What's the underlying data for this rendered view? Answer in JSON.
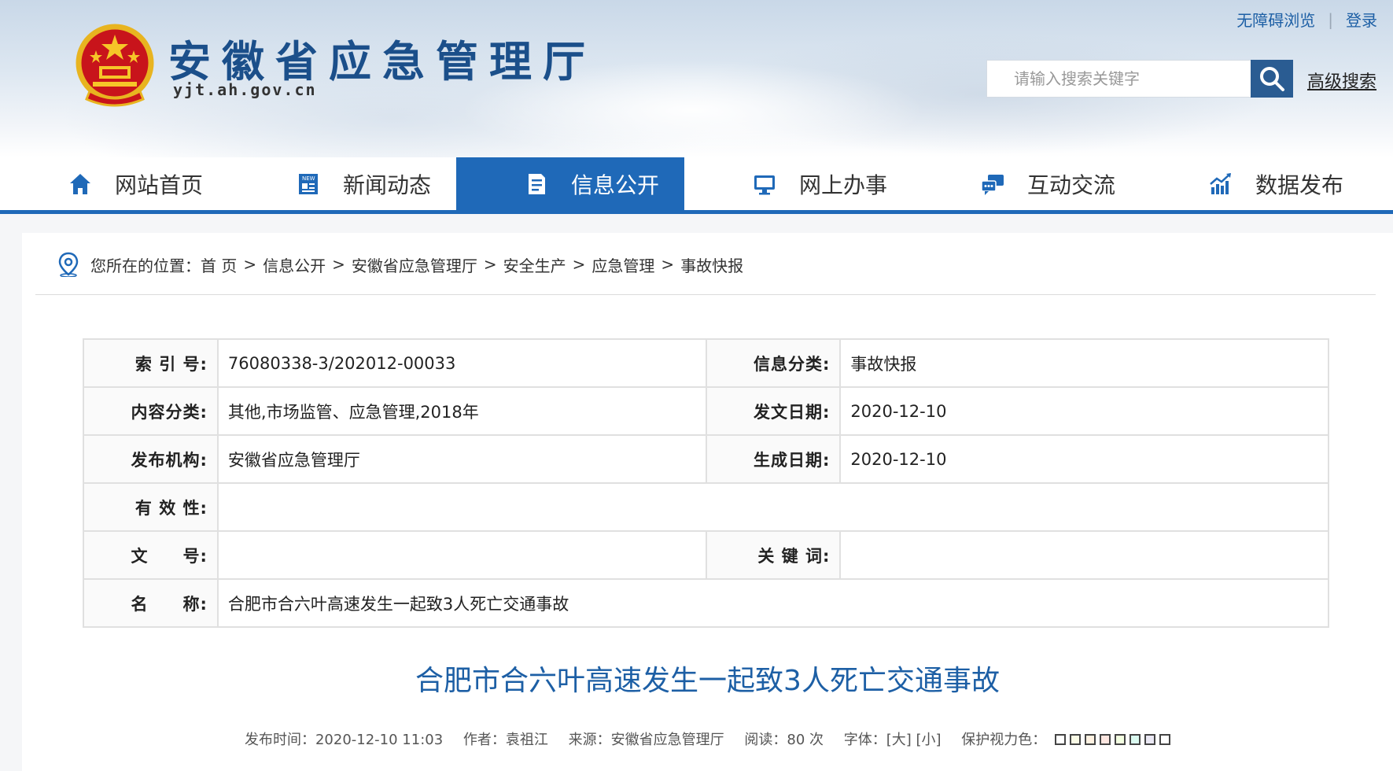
{
  "header": {
    "site_title": "安徽省应急管理厅",
    "site_domain": "yjt.ah.gov.cn",
    "top_links": [
      "无障碍浏览",
      "登录"
    ],
    "search_placeholder": "请输入搜索关键字",
    "advanced_search": "高级搜索"
  },
  "nav": {
    "items": [
      {
        "label": "网站首页",
        "icon": "home-icon"
      },
      {
        "label": "新闻动态",
        "icon": "news-icon"
      },
      {
        "label": "信息公开",
        "icon": "document-icon",
        "active": true
      },
      {
        "label": "网上办事",
        "icon": "monitor-icon"
      },
      {
        "label": "互动交流",
        "icon": "chat-icon"
      },
      {
        "label": "数据发布",
        "icon": "chart-icon"
      }
    ],
    "active_color": "#1f69b8"
  },
  "breadcrumb": {
    "prefix": "您所在的位置：",
    "items": [
      "首 页",
      "信息公开",
      "安徽省应急管理厅",
      "安全生产",
      "应急管理",
      "事故快报"
    ],
    "separator": ">"
  },
  "meta": {
    "index_label": "索 引 号:",
    "index_value": "76080338-3/202012-00033",
    "category_label": "信息分类:",
    "category_value": "事故快报",
    "content_label": "内容分类:",
    "content_value": "其他,市场监管、应急管理,2018年",
    "issue_date_label": "发文日期:",
    "issue_date_value": "2020-12-10",
    "publisher_label": "发布机构:",
    "publisher_value": "安徽省应急管理厅",
    "created_date_label": "生成日期:",
    "created_date_value": "2020-12-10",
    "validity_label": "有 效 性:",
    "validity_value": "",
    "doc_no_label": "文　　号:",
    "doc_no_value": "",
    "keywords_label": "关 键 词:",
    "keywords_value": "",
    "name_label": "名　　称:",
    "name_value": "合肥市合六叶高速发生一起致3人死亡交通事故"
  },
  "article": {
    "title": "合肥市合六叶高速发生一起致3人死亡交通事故",
    "publish_time": "发布时间：2020-12-10 11:03",
    "author": "作者：袁祖江",
    "source": "来源：安徽省应急管理厅",
    "reads": "阅读：80 次",
    "font_size": "字体：[大] [小]",
    "eye_color_label": "保护视力色：",
    "eye_colors": [
      "#ffffff",
      "#fafbe6",
      "#fff2e2",
      "#fde6e0",
      "#f3ffe1",
      "#dafaf0",
      "#eae8f4",
      "#ffffff"
    ]
  }
}
